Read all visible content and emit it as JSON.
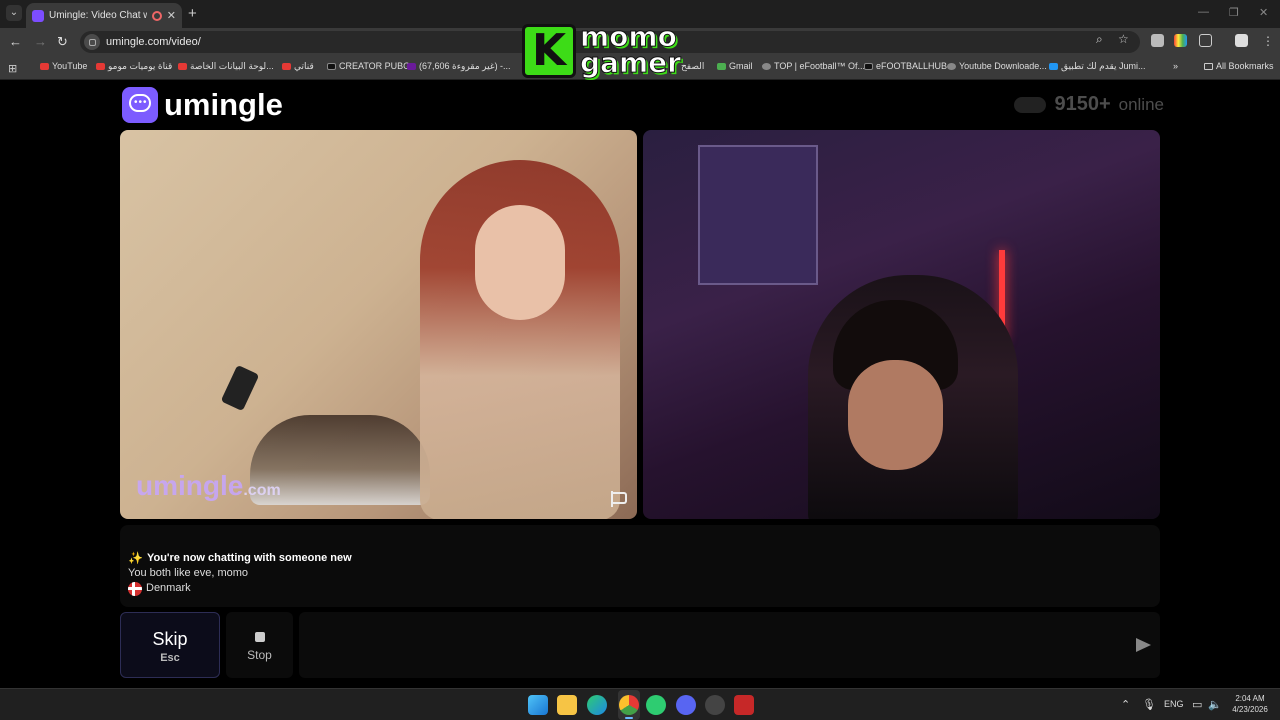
{
  "browser": {
    "tab_title": "Umingle: Video Chat with S",
    "tab_close": "✕",
    "new_tab": "+",
    "url": "umingle.com/video/",
    "all_bookmarks": "All Bookmarks",
    "bookmarks": [
      "YouTube",
      "قناة يوميات مومو",
      "لوحة البيانات الخاصة...",
      "قناتي",
      "CREATOR PUBG",
      "(67,606 غير مقروءة) -...",
      "الصفح",
      "Gmail",
      "TOP | eFootball™ Of...",
      "eFOOTBALLHUB",
      "Youtube Downloade...",
      "يقدم لك تطبيق Jumi..."
    ]
  },
  "overlay_logo": {
    "letter": "K",
    "word1": "momo",
    "word2": "gamer"
  },
  "site": {
    "brand": "umingle",
    "online_count": "9150+",
    "online_label": "online"
  },
  "video": {
    "watermark_main": "umingle",
    "watermark_suffix": ".com"
  },
  "chat": {
    "headline": "You're now chatting with someone new",
    "interests": "You both like eve, momo",
    "country": "Denmark"
  },
  "controls": {
    "skip_label": "Skip",
    "skip_key": "Esc",
    "stop_label": "Stop",
    "message_placeholder": ""
  },
  "taskbar": {
    "language": "ENG",
    "time": "2:04 AM",
    "date": "4/23/2026"
  },
  "colors": {
    "accent": "#7c5cff",
    "page_bg": "#000000",
    "panel_bg": "#0b0b0b"
  }
}
